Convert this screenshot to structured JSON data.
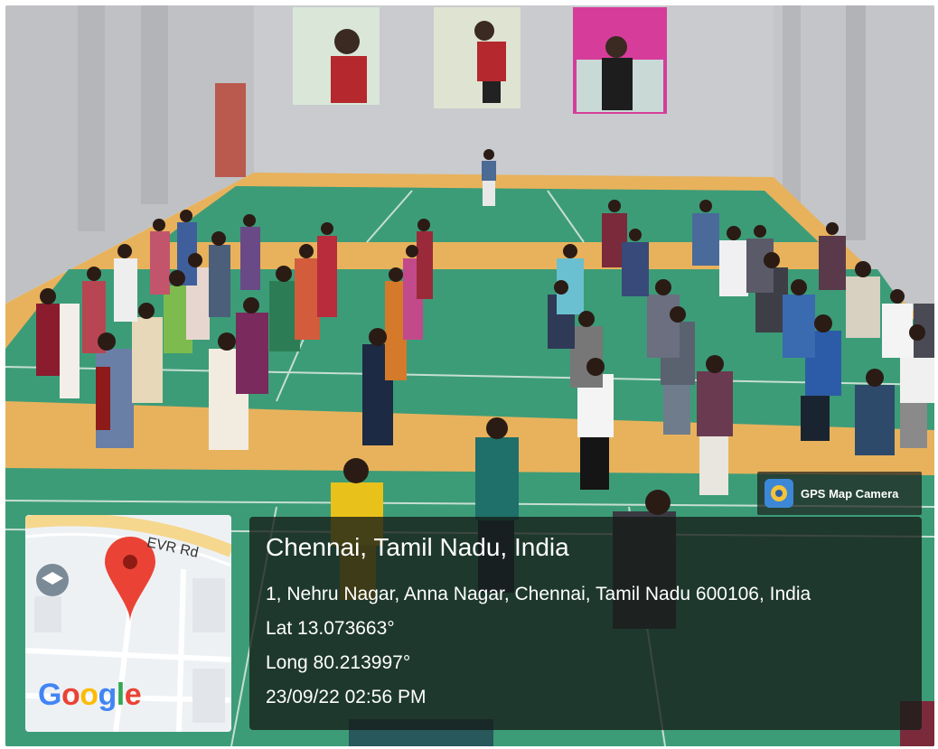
{
  "overlay": {
    "app_name": "GPS Map Camera",
    "place_title": "Chennai, Tamil Nadu, India",
    "address": "1, Nehru Nagar, Anna Nagar, Chennai, Tamil Nadu 600106, India",
    "latitude": "Lat 13.073663°",
    "longitude": "Long 80.213997°",
    "datetime": "23/09/22 02:56 PM"
  },
  "map": {
    "road_label": "EVR Rd",
    "brand": "Google",
    "brand_colors": [
      "#4285F4",
      "#EA4335",
      "#FBBC05",
      "#4285F4",
      "#34A853",
      "#EA4335"
    ],
    "pin_color": "#EA4335"
  },
  "scene": {
    "description_icons": [
      "badminton-poster",
      "person-standing"
    ]
  },
  "colors": {
    "court_green": "#3c9c78",
    "floor_orange": "#e8b25c",
    "wall_grey": "#c9cbce"
  }
}
